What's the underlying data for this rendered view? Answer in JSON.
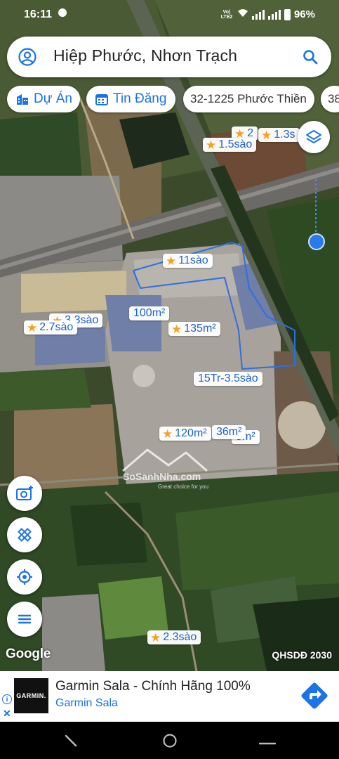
{
  "status_bar": {
    "time": "16:11",
    "network": "Vo) LTE2",
    "battery": "96%"
  },
  "search": {
    "query": "Hiệp Phước, Nhơn Trạch"
  },
  "chips": [
    {
      "label": "Dự Án",
      "icon": "building-icon"
    },
    {
      "label": "Tin Đăng",
      "icon": "calendar-icon"
    },
    {
      "label": "32-1225 Phước Thiền"
    },
    {
      "label": "38"
    }
  ],
  "map_labels": [
    {
      "text": "2",
      "star": true
    },
    {
      "text": "1.3s",
      "star": true
    },
    {
      "text": "1.5sào",
      "star": true
    },
    {
      "text": "11sào",
      "star": true
    },
    {
      "text": "3.3sào",
      "star": true
    },
    {
      "text": "2.7sào",
      "star": true
    },
    {
      "text": "100m²",
      "star": false
    },
    {
      "text": "135m²",
      "star": true
    },
    {
      "text": "15Tr-3.5sào",
      "star": false
    },
    {
      "text": "120m²",
      "star": true
    },
    {
      "text": "36m²",
      "star": false
    },
    {
      "text": "5m²",
      "star": false
    },
    {
      "text": "2.3sào",
      "star": true
    }
  ],
  "watermark": {
    "name": "SoSanhNha.com",
    "tagline": "Great choice for you"
  },
  "map_footer": {
    "google": "Google",
    "layer_name": "QHSDĐ 2030"
  },
  "ad": {
    "brand_logo": "GARMIN.",
    "title": "Garmin Sala - Chính Hãng 100%",
    "subtitle": "Garmin Sala"
  },
  "colors": {
    "accent": "#1a73e8",
    "star": "#f3a21b",
    "location_dot": "#1a73e8"
  }
}
